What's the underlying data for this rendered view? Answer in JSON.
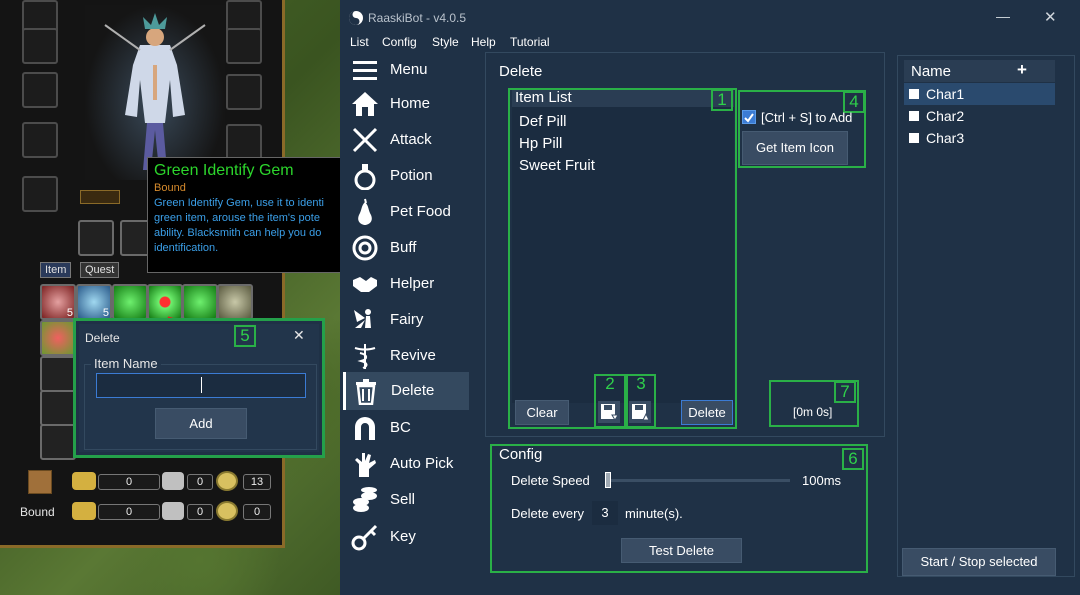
{
  "game": {
    "tabs": {
      "item": "Item",
      "quest": "Quest"
    },
    "stack_counts": [
      "5",
      "5"
    ],
    "currency_label": "Bound",
    "coin_row1": [
      "0",
      "0",
      "13"
    ],
    "coin_row2": [
      "0",
      "0",
      "0"
    ],
    "tooltip": {
      "title": "Green Identify Gem",
      "bound": "Bound",
      "description": "Green Identify Gem, use it to identi green item, arouse the item's pote ability.  Blacksmith can help you do identification."
    }
  },
  "small_dialog": {
    "title": "Delete",
    "annotation": "5",
    "group_label": "Item Name",
    "input_value": "",
    "add_label": "Add",
    "close_glyph": "✕"
  },
  "window": {
    "title": "RaaskiBot - v4.0.5",
    "minimize_glyph": "—",
    "close_glyph": "✕",
    "menubar": [
      "List",
      "Config",
      "Style",
      "Help",
      "Tutorial"
    ]
  },
  "sidebar": {
    "items": [
      {
        "label": "Menu",
        "icon": "hamburger-icon"
      },
      {
        "label": "Home",
        "icon": "home-icon"
      },
      {
        "label": "Attack",
        "icon": "swords-icon"
      },
      {
        "label": "Potion",
        "icon": "potion-icon"
      },
      {
        "label": "Pet Food",
        "icon": "pear-icon"
      },
      {
        "label": "Buff",
        "icon": "swirl-icon"
      },
      {
        "label": "Helper",
        "icon": "handshake-icon"
      },
      {
        "label": "Fairy",
        "icon": "fairy-icon"
      },
      {
        "label": "Revive",
        "icon": "caduceus-icon"
      },
      {
        "label": "Delete",
        "icon": "trash-icon"
      },
      {
        "label": "BC",
        "icon": "magnet-icon"
      },
      {
        "label": "Auto Pick",
        "icon": "hand-icon"
      },
      {
        "label": "Sell",
        "icon": "coins-icon"
      },
      {
        "label": "Key",
        "icon": "key-icon"
      }
    ],
    "active": "Delete"
  },
  "delete_panel": {
    "title": "Delete",
    "item_list": {
      "header": "Item List",
      "annotation": "1",
      "items": [
        "Def Pill",
        "Hp Pill",
        "Sweet Fruit"
      ]
    },
    "clear_label": "Clear",
    "delete_label": "Delete",
    "annotation_2": "2",
    "annotation_3": "3",
    "annotation_4": "4",
    "annotation_7": "7",
    "ctrl_s_label": "[Ctrl + S] to Add",
    "ctrl_s_checked": true,
    "get_icon_label": "Get Item Icon",
    "timer": "[0m 0s]"
  },
  "config_panel": {
    "title": "Config",
    "annotation": "6",
    "speed_label": "Delete Speed",
    "speed_value": "100ms",
    "every_label": "Delete every",
    "every_value": "3",
    "every_unit": "minute(s).",
    "test_label": "Test Delete"
  },
  "char_panel": {
    "header": "Name",
    "add_glyph": "+",
    "chars": [
      "Char1",
      "Char2",
      "Char3"
    ],
    "selected": "Char1",
    "start_stop_label": "Start / Stop selected"
  },
  "colors": {
    "window_bg": "#1f3146",
    "annotation_green": "#2ab047",
    "list_bg": "#1b2c40"
  }
}
